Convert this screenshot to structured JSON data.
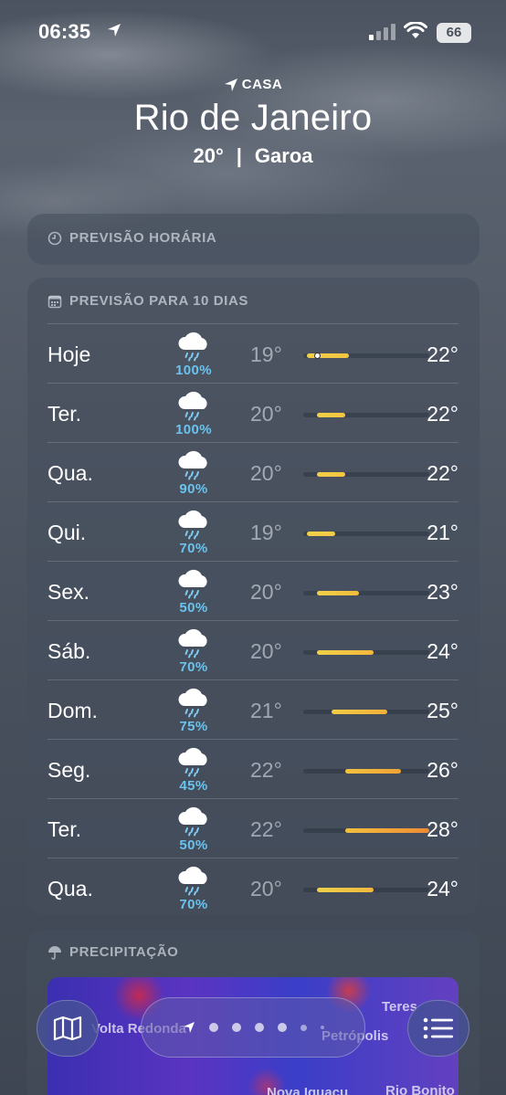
{
  "status_bar": {
    "time": "06:35",
    "battery": "66"
  },
  "header": {
    "location_label": "CASA",
    "city": "Rio de Janeiro",
    "temperature": "20°",
    "separator": "|",
    "condition": "Garoa"
  },
  "hourly": {
    "title": "PREVISÃO HORÁRIA"
  },
  "daily": {
    "title": "PREVISÃO PARA 10 DIAS",
    "scale_min": 19,
    "scale_max": 28,
    "days": [
      {
        "name": "Hoje",
        "pop": "100%",
        "low": "19°",
        "high": "22°",
        "low_value": 19,
        "high_value": 22,
        "current_value": 20,
        "colors": [
          "#f1d049",
          "#f4c43f"
        ]
      },
      {
        "name": "Ter.",
        "pop": "100%",
        "low": "20°",
        "high": "22°",
        "low_value": 20,
        "high_value": 22,
        "colors": [
          "#f1d049",
          "#f4c43f"
        ]
      },
      {
        "name": "Qua.",
        "pop": "90%",
        "low": "20°",
        "high": "22°",
        "low_value": 20,
        "high_value": 22,
        "colors": [
          "#f1d049",
          "#f4c43f"
        ]
      },
      {
        "name": "Qui.",
        "pop": "70%",
        "low": "19°",
        "high": "21°",
        "low_value": 19,
        "high_value": 21,
        "colors": [
          "#f1d049",
          "#f2cc44"
        ]
      },
      {
        "name": "Sex.",
        "pop": "50%",
        "low": "20°",
        "high": "23°",
        "low_value": 20,
        "high_value": 23,
        "colors": [
          "#f1d049",
          "#f3bc3c"
        ]
      },
      {
        "name": "Sáb.",
        "pop": "70%",
        "low": "20°",
        "high": "24°",
        "low_value": 20,
        "high_value": 24,
        "colors": [
          "#f1d049",
          "#f3b83c"
        ]
      },
      {
        "name": "Dom.",
        "pop": "75%",
        "low": "21°",
        "high": "25°",
        "low_value": 21,
        "high_value": 25,
        "colors": [
          "#f2cc44",
          "#f2b03a"
        ]
      },
      {
        "name": "Seg.",
        "pop": "45%",
        "low": "22°",
        "high": "26°",
        "low_value": 22,
        "high_value": 26,
        "colors": [
          "#f3c23e",
          "#f0a237"
        ]
      },
      {
        "name": "Ter.",
        "pop": "50%",
        "low": "22°",
        "high": "28°",
        "low_value": 22,
        "high_value": 28,
        "colors": [
          "#f3c03e",
          "#ee8a35"
        ]
      },
      {
        "name": "Qua.",
        "pop": "70%",
        "low": "20°",
        "high": "24°",
        "low_value": 20,
        "high_value": 24,
        "colors": [
          "#f1d049",
          "#f3b83c"
        ]
      }
    ]
  },
  "precipitation": {
    "title": "PRECIPITAÇÃO",
    "map_labels": [
      "Volta Redonda",
      "Petrópolis",
      "Teres",
      "Rio Bonito",
      "Nova Iguaçu"
    ]
  },
  "icons": {
    "location": "location-arrow-icon",
    "clock": "clock-icon",
    "calendar": "calendar-icon",
    "umbrella": "umbrella-icon",
    "rain": "cloud-rain-icon",
    "map": "map-icon",
    "list": "list-icon"
  }
}
